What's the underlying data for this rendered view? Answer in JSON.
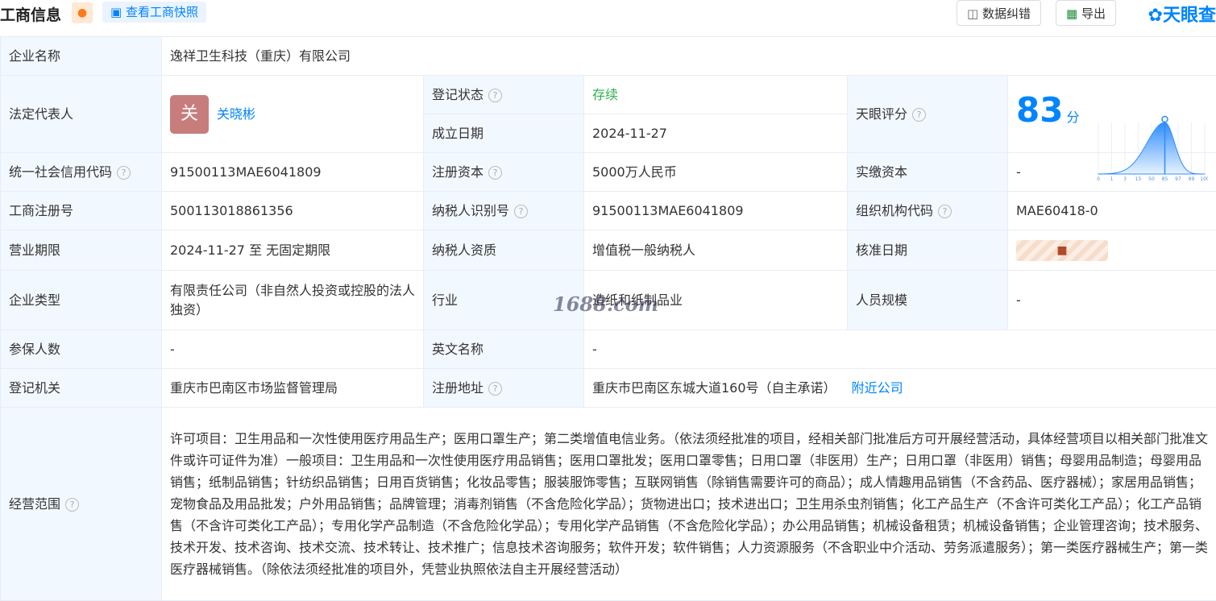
{
  "header": {
    "title": "工商信息",
    "bell_icon": "bell-icon",
    "snapshot_label": "查看工商快照",
    "correct_label": "数据纠错",
    "export_label": "导出",
    "brand": "天眼查"
  },
  "rows": {
    "company_name_label": "企业名称",
    "company_name": "逸祥卫生科技（重庆）有限公司",
    "legal_rep_label": "法定代表人",
    "legal_rep_avatar": "关",
    "legal_rep": "关晓彬",
    "reg_status_label": "登记状态",
    "reg_status": "存续",
    "est_date_label": "成立日期",
    "est_date": "2024-11-27",
    "score_label": "天眼评分",
    "score": "83",
    "score_unit": "分",
    "credit_code_label": "统一社会信用代码",
    "credit_code": "91500113MAE6041809",
    "reg_capital_label": "注册资本",
    "reg_capital": "5000万人民币",
    "paid_capital_label": "实缴资本",
    "paid_capital": "-",
    "biz_reg_no_label": "工商注册号",
    "biz_reg_no": "500113018861356",
    "taxpayer_id_label": "纳税人识别号",
    "taxpayer_id": "91500113MAE6041809",
    "org_code_label": "组织机构代码",
    "org_code": "MAE60418-0",
    "term_label": "营业期限",
    "term": "2024-11-27 至 无固定期限",
    "tax_quality_label": "纳税人资质",
    "tax_quality": "增值税一般纳税人",
    "approve_date_label": "核准日期",
    "type_label": "企业类型",
    "type": "有限责任公司（非自然人投资或控股的法人独资）",
    "industry_label": "行业",
    "industry": "造纸和纸制品业",
    "staff_label": "人员规模",
    "staff": "-",
    "insured_label": "参保人数",
    "insured": "-",
    "en_name_label": "英文名称",
    "en_name": "-",
    "authority_label": "登记机关",
    "authority": "重庆市巴南区市场监督管理局",
    "address_label": "注册地址",
    "address": "重庆市巴南区东城大道160号（自主承诺）",
    "nearby_label": "附近公司",
    "scope_label": "经营范围",
    "scope": "许可项目：卫生用品和一次性使用医疗用品生产；医用口罩生产；第二类增值电信业务。（依法须经批准的项目，经相关部门批准后方可开展经营活动，具体经营项目以相关部门批准文件或许可证件为准）一般项目：卫生用品和一次性使用医疗用品销售；医用口罩批发；医用口罩零售；日用口罩（非医用）生产；日用口罩（非医用）销售；母婴用品制造；母婴用品销售；纸制品销售；针纺织品销售；日用百货销售；化妆品零售；服装服饰零售；互联网销售（除销售需要许可的商品）；成人情趣用品销售（不含药品、医疗器械）；家居用品销售；宠物食品及用品批发；户外用品销售；品牌管理；消毒剂销售（不含危险化学品）；货物进出口；技术进出口；卫生用杀虫剂销售；化工产品生产（不含许可类化工产品）；化工产品销售（不含许可类化工产品）；专用化学产品制造（不含危险化学品）；专用化学产品销售（不含危险化学品）；办公用品销售；机械设备租赁；机械设备销售；企业管理咨询；技术服务、技术开发、技术咨询、技术交流、技术转让、技术推广；信息技术咨询服务；软件开发；软件销售；人力资源服务（不含职业中介活动、劳务派遣服务）；第一类医疗器械生产；第一类医疗器械销售。（除依法须经批准的项目外，凭营业执照依法自主开展经营活动）"
  },
  "score_chart": {
    "ticks": [
      "0",
      "1",
      "3",
      "15",
      "50",
      "85",
      "97",
      "99",
      "100"
    ],
    "marker_value": 85
  },
  "watermark": "1688.com",
  "colors": {
    "accent": "#0084ff",
    "label_bg": "#f2f8ff",
    "status_green": "#2fb14d"
  }
}
